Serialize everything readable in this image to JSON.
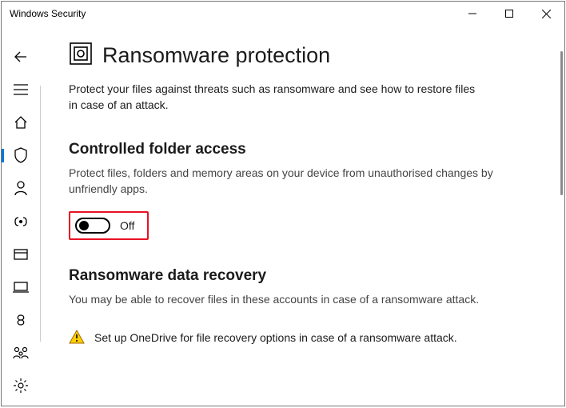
{
  "window": {
    "title": "Windows Security"
  },
  "page": {
    "title": "Ransomware protection",
    "description": "Protect your files against threats such as ransomware and see how to restore files in case of an attack."
  },
  "controlled_folder": {
    "heading": "Controlled folder access",
    "description": "Protect files, folders and memory areas on your device from unauthorised changes by unfriendly apps.",
    "toggle_state": "Off"
  },
  "data_recovery": {
    "heading": "Ransomware data recovery",
    "description": "You may be able to recover files in these accounts in case of a ransomware attack."
  },
  "onedrive": {
    "text": "Set up OneDrive for file recovery options in case of a ransomware attack."
  }
}
